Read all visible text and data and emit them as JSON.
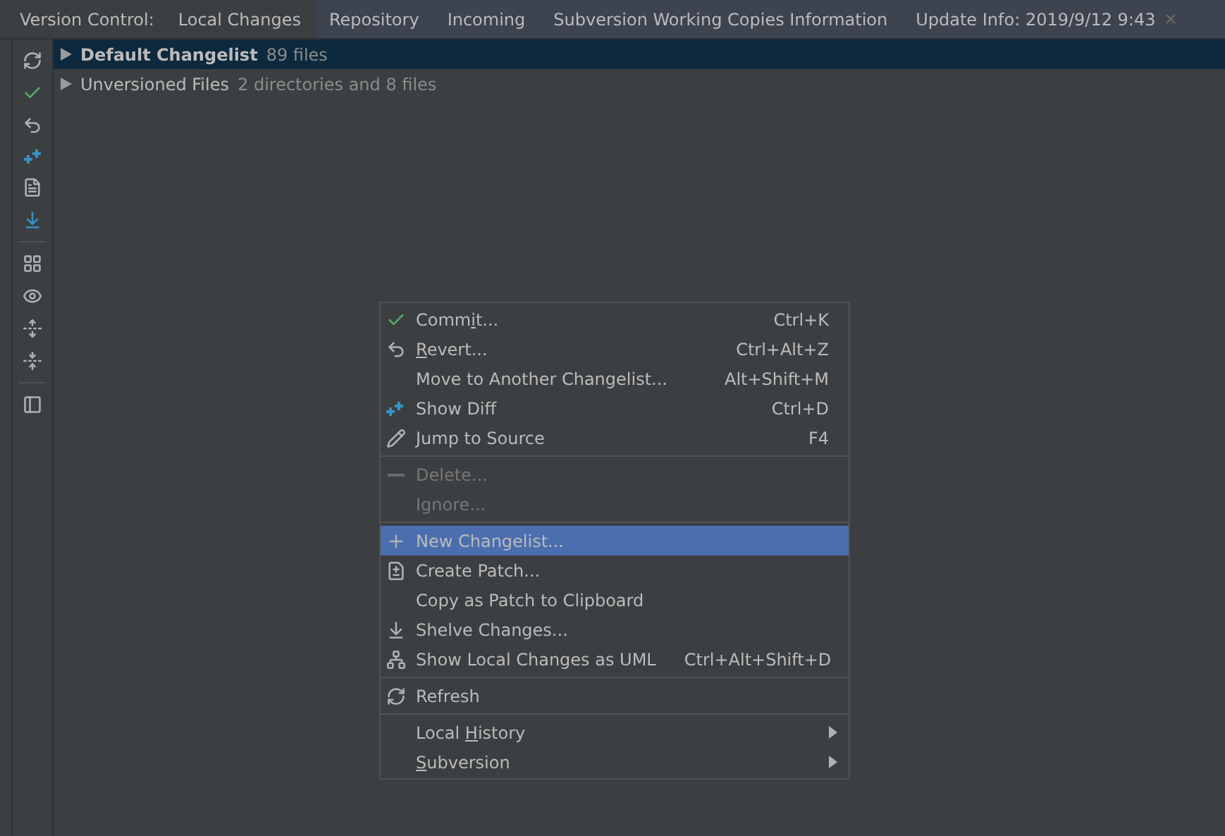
{
  "tool_window": {
    "title": "Version Control:"
  },
  "tabs": [
    {
      "label": "Local Changes",
      "selected": true,
      "closable": false
    },
    {
      "label": "Repository",
      "selected": false,
      "closable": false
    },
    {
      "label": "Incoming",
      "selected": false,
      "closable": false
    },
    {
      "label": "Subversion Working Copies Information",
      "selected": false,
      "closable": false
    },
    {
      "label": "Update Info: 2019/9/12 9:43",
      "selected": false,
      "closable": true
    }
  ],
  "tree": [
    {
      "name": "Default Changelist",
      "detail": "89 files",
      "selected": true,
      "bold": true,
      "expanded": false
    },
    {
      "name": "Unversioned Files",
      "detail": "2 directories and 8 files",
      "selected": false,
      "bold": false,
      "expanded": false
    }
  ],
  "context_menu": {
    "sections": [
      [
        {
          "label_before": "Comm",
          "mnemonic": "i",
          "label_after": "t...",
          "shortcut": "Ctrl+K",
          "disabled": false,
          "selected": false,
          "submenu": false
        },
        {
          "mnemonic": "R",
          "label_after": "evert...",
          "shortcut": "Ctrl+Alt+Z",
          "disabled": false,
          "selected": false,
          "submenu": false
        },
        {
          "label": "Move to Another Changelist...",
          "shortcut": "Alt+Shift+M",
          "disabled": false,
          "selected": false,
          "submenu": false
        },
        {
          "label": "Show Diff",
          "shortcut": "Ctrl+D",
          "disabled": false,
          "selected": false,
          "submenu": false
        },
        {
          "label": "Jump to Source",
          "shortcut": "F4",
          "disabled": false,
          "selected": false,
          "submenu": false
        }
      ],
      [
        {
          "label": "Delete...",
          "disabled": true,
          "selected": false,
          "submenu": false
        },
        {
          "label": "Ignore...",
          "disabled": true,
          "selected": false,
          "submenu": false
        }
      ],
      [
        {
          "label": "New Changelist...",
          "disabled": false,
          "selected": true,
          "submenu": false
        },
        {
          "label": "Create Patch...",
          "disabled": false,
          "selected": false,
          "submenu": false
        },
        {
          "label": "Copy as Patch to Clipboard",
          "disabled": false,
          "selected": false,
          "submenu": false
        },
        {
          "label": "Shelve Changes...",
          "disabled": false,
          "selected": false,
          "submenu": false
        },
        {
          "label": "Show Local Changes as UML",
          "shortcut": "Ctrl+Alt+Shift+D",
          "disabled": false,
          "selected": false,
          "submenu": false
        }
      ],
      [
        {
          "label": "Refresh",
          "disabled": false,
          "selected": false,
          "submenu": false
        }
      ],
      [
        {
          "label_before": "Local ",
          "mnemonic": "H",
          "label_after": "istory",
          "disabled": false,
          "selected": false,
          "submenu": true
        },
        {
          "mnemonic": "S",
          "label_after": "ubversion",
          "disabled": false,
          "selected": false,
          "submenu": true
        }
      ]
    ]
  }
}
